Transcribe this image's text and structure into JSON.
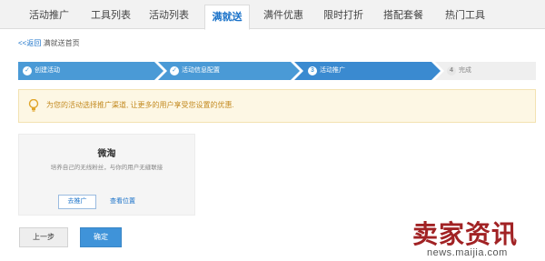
{
  "tabs": [
    {
      "label": "活动推广",
      "active": false
    },
    {
      "label": "工具列表",
      "active": false
    },
    {
      "label": "活动列表",
      "active": false
    },
    {
      "label": "满就送",
      "active": true
    },
    {
      "label": "满件优惠",
      "active": false
    },
    {
      "label": "限时打折",
      "active": false
    },
    {
      "label": "搭配套餐",
      "active": false
    },
    {
      "label": "热门工具",
      "active": false
    }
  ],
  "breadcrumb": {
    "back": "<<返回",
    "current": "满就送首页"
  },
  "steps": [
    {
      "label": "创建活动",
      "state": "done",
      "icon": "check-icon"
    },
    {
      "label": "活动信息配置",
      "state": "done",
      "icon": "check-icon"
    },
    {
      "label": "活动推广",
      "state": "current",
      "number": "3"
    },
    {
      "label": "完成",
      "state": "todo",
      "number": "4"
    }
  ],
  "notice": {
    "icon": "lightbulb-icon",
    "text": "为您的活动选择推广渠道, 让更多的用户享受您设置的优惠."
  },
  "card": {
    "title": "微淘",
    "description": "培养自己的无线粉丝，与你的用户无缝联接",
    "promote_label": "去推广",
    "view_label": "查看位置"
  },
  "actions": {
    "prev_label": "上一步",
    "ok_label": "确定"
  },
  "watermark": {
    "brand": "卖家资讯",
    "url": "news.maijia.com"
  },
  "colors": {
    "accent": "#1a72c9",
    "step_blue": "#4a9ad6",
    "notice_text": "#c38a20",
    "brand_red": "#a12224"
  }
}
